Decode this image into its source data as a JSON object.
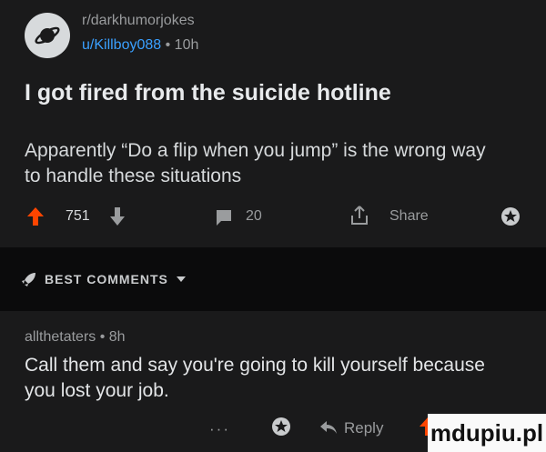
{
  "post": {
    "subreddit": "r/darkhumorjokes",
    "username": "u/Killboy088",
    "time_sep": " • ",
    "time": "10h",
    "title": "I got fired from the suicide hotline",
    "body": "Apparently “Do a flip when you jump” is the wrong way to handle these situations",
    "score": "751",
    "comments_count": "20",
    "share_label": "Share"
  },
  "best_comments": {
    "label": "BEST COMMENTS"
  },
  "comment": {
    "author": "allthetaters",
    "time_sep": " • ",
    "time": "8h",
    "text": "Call them and say you're going to kill yourself because you lost your job.",
    "more": "···",
    "reply_label": "Reply"
  },
  "watermark": "mdupiu.pl",
  "colors": {
    "background": "#1a1a1b",
    "upvote": "#ff4500",
    "link": "#3aa0ff",
    "separator": "#0b0b0c"
  }
}
